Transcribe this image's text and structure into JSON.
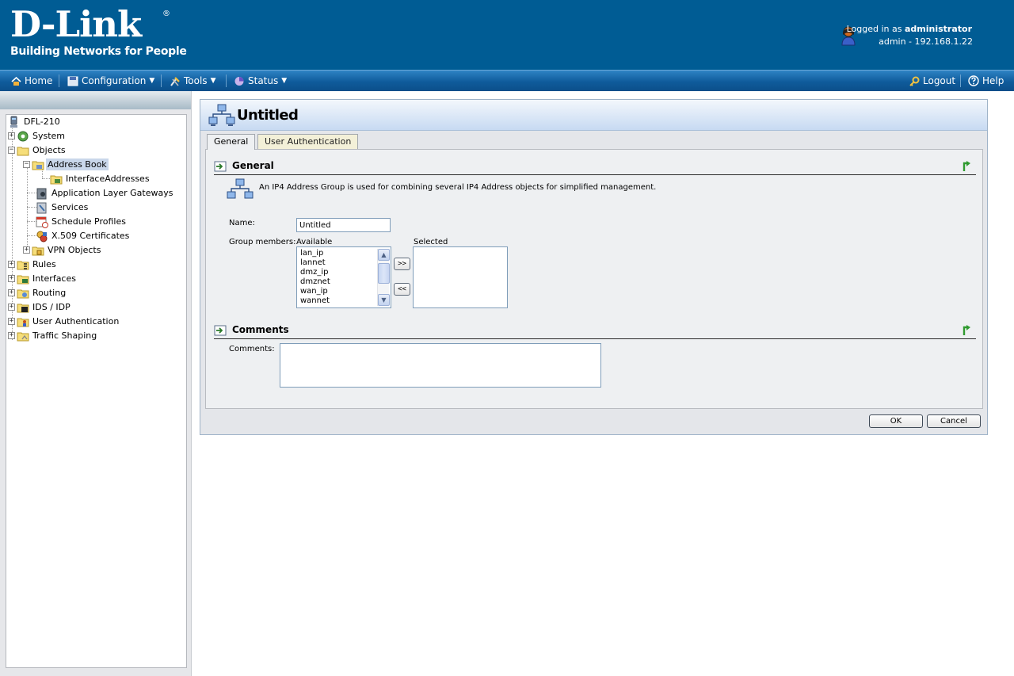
{
  "header": {
    "logo_text": "D-Link",
    "logo_reg": "®",
    "tagline": "Building Networks for People",
    "logged_in_prefix": "Logged in as",
    "logged_in_user": "administrator",
    "session_info": "admin - 192.168.1.22"
  },
  "nav": {
    "home": "Home",
    "configuration": "Configuration",
    "tools": "Tools",
    "status": "Status",
    "logout": "Logout",
    "help": "Help",
    "caret": "▼"
  },
  "tree": {
    "root": "DFL-210",
    "items": [
      {
        "label": "System"
      },
      {
        "label": "Objects"
      },
      {
        "label": "Address Book"
      },
      {
        "label": "InterfaceAddresses"
      },
      {
        "label": "Application Layer Gateways"
      },
      {
        "label": "Services"
      },
      {
        "label": "Schedule Profiles"
      },
      {
        "label": "X.509 Certificates"
      },
      {
        "label": "VPN Objects"
      },
      {
        "label": "Rules"
      },
      {
        "label": "Interfaces"
      },
      {
        "label": "Routing"
      },
      {
        "label": "IDS / IDP"
      },
      {
        "label": "User Authentication"
      },
      {
        "label": "Traffic Shaping"
      }
    ],
    "plus": "+",
    "minus": "−"
  },
  "main": {
    "title": "Untitled",
    "tabs": [
      "General",
      "User Authentication"
    ],
    "general_section": "General",
    "description": "An IP4 Address Group is used for combining several IP4 Address objects for simplified management.",
    "name_label": "Name:",
    "name_value": "Untitled",
    "group_members_label": "Group members:",
    "available_label": "Available",
    "selected_label": "Selected",
    "available_options": [
      "lan_ip",
      "lannet",
      "dmz_ip",
      "dmznet",
      "wan_ip",
      "wannet"
    ],
    "add_button": ">>",
    "remove_button": "<<",
    "comments_section": "Comments",
    "comments_label": "Comments:",
    "comments_value": "",
    "ok_button": "OK",
    "cancel_button": "Cancel",
    "scroll_up": "▲",
    "scroll_down": "▼"
  }
}
